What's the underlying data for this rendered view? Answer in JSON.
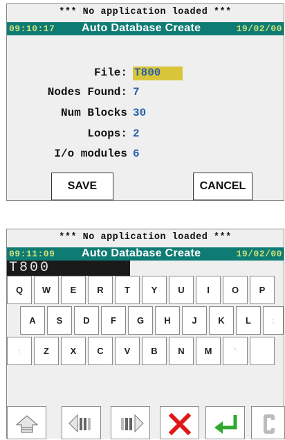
{
  "panel1": {
    "status": "*** No application loaded ***",
    "time": "09:10:17",
    "title": "Auto Database Create",
    "date": "19/02/00",
    "fields": [
      {
        "label": "File:",
        "value": "T800"
      },
      {
        "label": "Nodes Found:",
        "value": "7"
      },
      {
        "label": "Num Blocks",
        "value": "30"
      },
      {
        "label": "Loops:",
        "value": "2"
      },
      {
        "label": "I/o modules",
        "value": "6"
      }
    ],
    "save_label": "SAVE",
    "cancel_label": "CANCEL"
  },
  "panel2": {
    "status": "*** No application loaded ***",
    "time": "09:11:09",
    "title": "Auto Database Create",
    "date": "19/02/00",
    "entry_text": "T800",
    "keys_row1": [
      "Q",
      "W",
      "E",
      "R",
      "T",
      "Y",
      "U",
      "I",
      "O",
      "P"
    ],
    "keys_row2": [
      "A",
      "S",
      "D",
      "F",
      "G",
      "H",
      "J",
      "K",
      "L",
      ":"
    ],
    "keys_row3": [
      "↑",
      "Z",
      "X",
      "C",
      "V",
      "B",
      "N",
      "M",
      "'",
      ""
    ],
    "controls": [
      "shift-lock-icon",
      "cursor-left-icon",
      "cursor-right-icon",
      "cancel-x-icon",
      "enter-icon",
      "clear-c-icon"
    ]
  },
  "colors": {
    "titlebar": "#0f7c74",
    "clock": "#cfe27c",
    "value": "#2a5fa8",
    "file_highlight": "#d8c53a",
    "cancel_red": "#e01818",
    "enter_green": "#2fa82f"
  }
}
